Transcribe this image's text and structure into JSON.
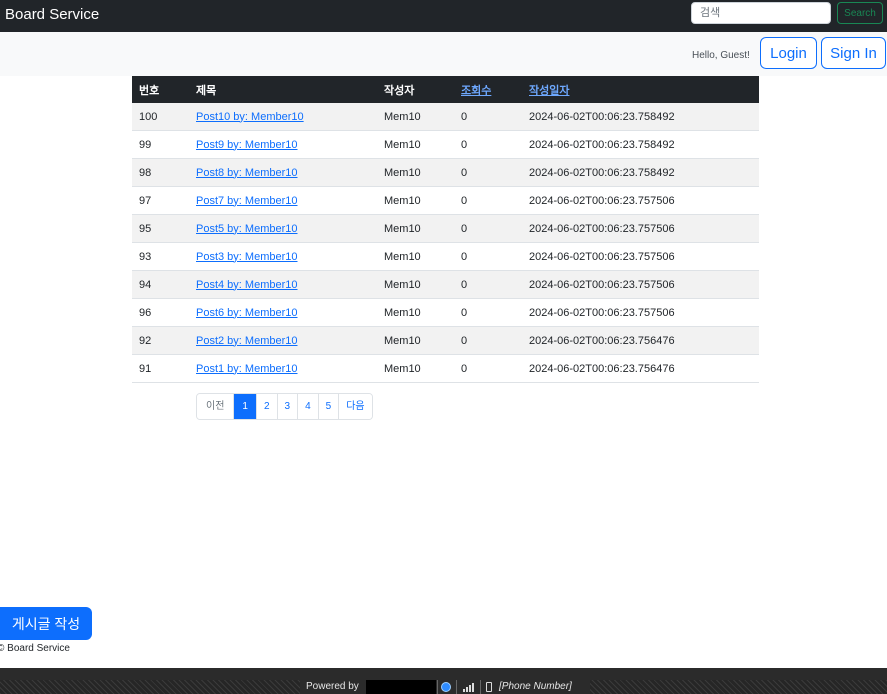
{
  "navbar": {
    "brand": "Board Service",
    "search_placeholder": "검색",
    "search_button": "Search"
  },
  "auth": {
    "greeting": "Hello, Guest!",
    "login": "Login",
    "signin": "Sign In"
  },
  "table": {
    "headers": {
      "no": "번호",
      "title": "제목",
      "author": "작성자",
      "views": "조회수",
      "date": "작성일자"
    },
    "rows": [
      {
        "no": "100",
        "title": "Post10 by: Member10",
        "author": "Mem10",
        "views": "0",
        "date": "2024-06-02T00:06:23.758492"
      },
      {
        "no": "99",
        "title": "Post9 by: Member10",
        "author": "Mem10",
        "views": "0",
        "date": "2024-06-02T00:06:23.758492"
      },
      {
        "no": "98",
        "title": "Post8 by: Member10",
        "author": "Mem10",
        "views": "0",
        "date": "2024-06-02T00:06:23.758492"
      },
      {
        "no": "97",
        "title": "Post7 by: Member10",
        "author": "Mem10",
        "views": "0",
        "date": "2024-06-02T00:06:23.757506"
      },
      {
        "no": "95",
        "title": "Post5 by: Member10",
        "author": "Mem10",
        "views": "0",
        "date": "2024-06-02T00:06:23.757506"
      },
      {
        "no": "93",
        "title": "Post3 by: Member10",
        "author": "Mem10",
        "views": "0",
        "date": "2024-06-02T00:06:23.757506"
      },
      {
        "no": "94",
        "title": "Post4 by: Member10",
        "author": "Mem10",
        "views": "0",
        "date": "2024-06-02T00:06:23.757506"
      },
      {
        "no": "96",
        "title": "Post6 by: Member10",
        "author": "Mem10",
        "views": "0",
        "date": "2024-06-02T00:06:23.757506"
      },
      {
        "no": "92",
        "title": "Post2 by: Member10",
        "author": "Mem10",
        "views": "0",
        "date": "2024-06-02T00:06:23.756476"
      },
      {
        "no": "91",
        "title": "Post1 by: Member10",
        "author": "Mem10",
        "views": "0",
        "date": "2024-06-02T00:06:23.756476"
      }
    ]
  },
  "pagination": {
    "prev": "이전",
    "pages": [
      "1",
      "2",
      "3",
      "4",
      "5"
    ],
    "active_page": "1",
    "next": "다음"
  },
  "write_button": "게시글 작성",
  "copyright": "© Board Service",
  "footer": {
    "powered_by": "Powered by",
    "phone": "[Phone Number]",
    "icons": [
      "github-icon",
      "signal-icon",
      "phone-icon"
    ]
  },
  "colors": {
    "navbar": "#212529",
    "primary": "#0d6efd",
    "success": "#198754",
    "link_header": "#6ea8fe"
  }
}
